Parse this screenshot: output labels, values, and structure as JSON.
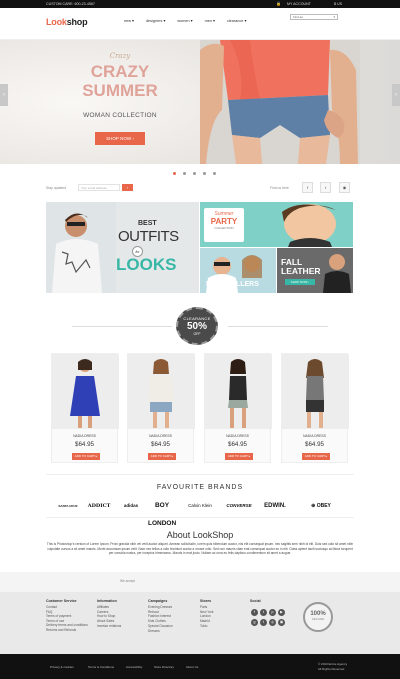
{
  "topbar": {
    "customer_care": "CUSTOM CARE: 600-23-4567",
    "account": "MY ACCOUNT",
    "currency": "$ US"
  },
  "header": {
    "logo_accent": "Look",
    "logo_rest": "shop",
    "nav": [
      "new ▾",
      "designers ▾",
      "women ▾",
      "men ▾",
      "clearance ▾"
    ],
    "search_placeholder": "Find an"
  },
  "hero": {
    "script": "Crazy",
    "title": "CRAZY SUMMER",
    "subtitle": "WOMAN COLLECTION",
    "cta": "SHOP NOW ›",
    "slide_count": 5,
    "active_slide": 1
  },
  "subbar": {
    "stay_updated": "Stay updated",
    "email_placeholder": "Your email address",
    "find_us": "Find us here",
    "social": [
      "f",
      "t",
      "◉"
    ]
  },
  "promos": {
    "best": "BEST",
    "outfits": "OUTFITS",
    "for": "for",
    "looks": "LOOKS",
    "summer": "Summer",
    "party": "PARTY",
    "collection": "COLLECTION",
    "best_sellers": "BEST SELLERS",
    "fall": "FALL",
    "leather": "LEATHER",
    "shop_now": "SHOP NOW ›"
  },
  "clearance": {
    "label": "CLEARANCE",
    "percent": "50%",
    "off": "OFF"
  },
  "products": [
    {
      "name": "NADIA DRESS",
      "price": "$64.95",
      "button": "ADD TO CART ▸",
      "color": "#2f3fb5"
    },
    {
      "name": "NADIA DRESS",
      "price": "$64.95",
      "button": "ADD TO CART ▸",
      "color": "#f0ece6"
    },
    {
      "name": "NADIA DRESS",
      "price": "$64.95",
      "button": "ADD TO CART ▸",
      "color": "#2a2a2a"
    },
    {
      "name": "NADIA DRESS",
      "price": "$64.95",
      "button": "ADD TO CART ▸",
      "color": "#444444"
    }
  ],
  "brands": {
    "title": "FAVOURITE BRANDS",
    "items": [
      "SANTA CRUZ",
      "ADDICT",
      "adidas",
      "BOY LONDON",
      "Calvin Klein",
      "CONVERSE",
      "EDWIN.",
      "⊕ OBEY"
    ]
  },
  "about": {
    "title": "About LookShop",
    "text": "This is Photoshop's version of Lorem Ipsum. Proin gravida nibh vel velit auctor aliquet. Aenean sollicitudin, lorem quis bibendum auctor, nisi elit consequat ipsum, nec sagittis sem nibh id elit. Duis sed odio sit amet nibh vulputate cursus a sit amet mauris. Morbi accumsan ipsum velit. Nam nec tellus a odio tincidunt auctor a ornare odio. Sed non mauris vitae erat consequat auctor eu in elit. Class aptent taciti sociosqu ad litora torquent per conubia nostra, per inceptos himenaeos. Mauris in erat justo. Nullam ac urna eu felis dapibus condimentum sit amet a augue."
  },
  "newsletter": {
    "we_accept": "We accept"
  },
  "footer": {
    "cols": [
      {
        "title": "Customer Service",
        "items": [
          "Contact",
          "FAQ",
          "Terms of payment",
          "Terms of use",
          "Delivery terms and conditions",
          "Returns and Refunds"
        ]
      },
      {
        "title": "Information",
        "items": [
          "Affiliates",
          "Careers",
          "How to Shop",
          "About Sales",
          "Investor relations"
        ]
      },
      {
        "title": "Campaigns",
        "items": [
          "Evening Dresses",
          "Rebooz",
          "Fashion Interest",
          "Kids Clothes",
          "Special Occasion",
          "Dresses"
        ]
      },
      {
        "title": "Stores",
        "items": [
          "Paris",
          "New York",
          "London",
          "Madrid",
          "Tokio"
        ]
      },
      {
        "title": "Social",
        "items": []
      }
    ],
    "social_icons": [
      "f",
      "t",
      "p",
      "▶",
      "g",
      "t",
      "◎",
      "▣"
    ],
    "badge_top": "100%",
    "badge_bottom": "SECURE"
  },
  "bottom": {
    "links": [
      "Privacy & cookies",
      "Terms & Conditions",
      "Accessibility",
      "Store Directory",
      "About Us"
    ],
    "copyright": "© 2013 Entire Agency",
    "rights": "All Rights Reserved"
  },
  "colors": {
    "accent": "#e8664a",
    "dark": "#111111",
    "footer": "#e9e9e9"
  }
}
